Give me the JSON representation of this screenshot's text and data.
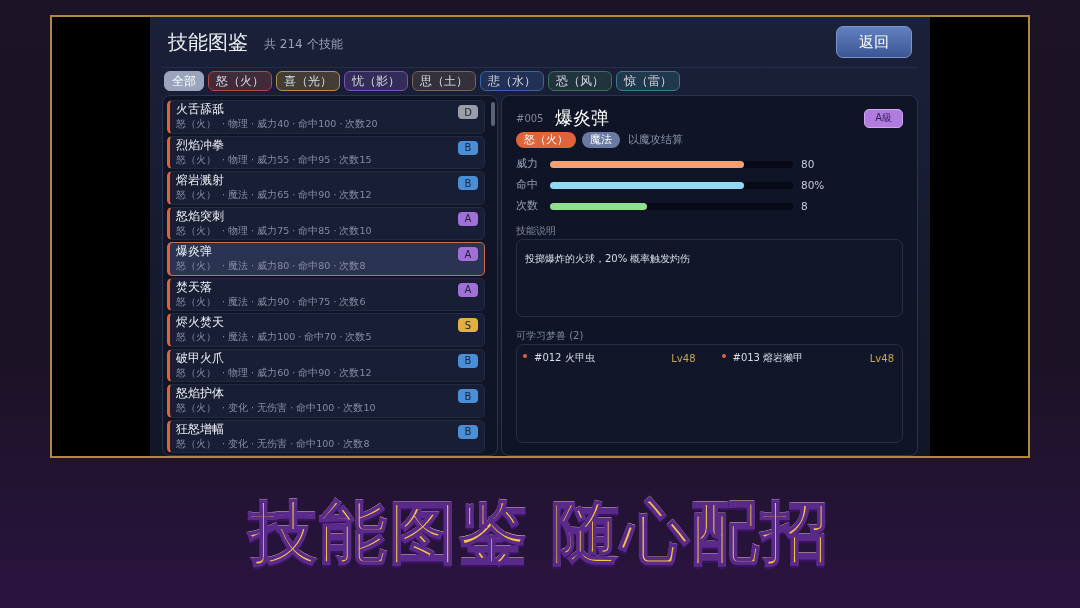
{
  "header": {
    "title": "技能图鉴",
    "count": "共 214 个技能",
    "back_button": "返回"
  },
  "tabs": [
    {
      "label": "全部",
      "selected": true,
      "color": "#9aa4bc"
    },
    {
      "label": "怒（火）",
      "selected": false,
      "color": "#b04a42"
    },
    {
      "label": "喜（光）",
      "selected": false,
      "color": "#b8923a"
    },
    {
      "label": "忧（影）",
      "selected": false,
      "color": "#7a52b8"
    },
    {
      "label": "思（土）",
      "selected": false,
      "color": "#806250"
    },
    {
      "label": "悲（水）",
      "selected": false,
      "color": "#3a62a8"
    },
    {
      "label": "恐（风）",
      "selected": false,
      "color": "#3a7258"
    },
    {
      "label": "惊（雷）",
      "selected": false,
      "color": "#3a7c8c"
    }
  ],
  "skills": [
    {
      "name": "火舌舔舐",
      "meta": "怒（火）  · 物理 · 威力40 · 命中100 · 次数20",
      "grade": "D",
      "color": "#9a9ea8",
      "selected": false
    },
    {
      "name": "烈焰冲拳",
      "meta": "怒（火）  · 物理 · 威力55 · 命中95 · 次数15",
      "grade": "B",
      "color": "#4a8ed6",
      "selected": false
    },
    {
      "name": "熔岩溅射",
      "meta": "怒（火）  · 魔法 · 威力65 · 命中90 · 次数12",
      "grade": "B",
      "color": "#4a8ed6",
      "selected": false
    },
    {
      "name": "怒焰突刺",
      "meta": "怒（火）  · 物理 · 威力75 · 命中85 · 次数10",
      "grade": "A",
      "color": "#a070d8",
      "selected": false
    },
    {
      "name": "爆炎弹",
      "meta": "怒（火）  · 魔法 · 威力80 · 命中80 · 次数8",
      "grade": "A",
      "color": "#a070d8",
      "selected": true
    },
    {
      "name": "焚天落",
      "meta": "怒（火）  · 魔法 · 威力90 · 命中75 · 次数6",
      "grade": "A",
      "color": "#a070d8",
      "selected": false
    },
    {
      "name": "烬火焚天",
      "meta": "怒（火）  · 魔法 · 威力100 · 命中70 · 次数5",
      "grade": "S",
      "color": "#e0b040",
      "selected": false
    },
    {
      "name": "破甲火爪",
      "meta": "怒（火）  · 物理 · 威力60 · 命中90 · 次数12",
      "grade": "B",
      "color": "#4a8ed6",
      "selected": false
    },
    {
      "name": "怒焰护体",
      "meta": "怒（火）  · 变化 · 无伤害 · 命中100 · 次数10",
      "grade": "B",
      "color": "#4a8ed6",
      "selected": false
    },
    {
      "name": "狂怒增幅",
      "meta": "怒（火）  · 变化 · 无伤害 · 命中100 · 次数8",
      "grade": "B",
      "color": "#4a8ed6",
      "selected": false
    }
  ],
  "detail": {
    "number": "#005",
    "name": "爆炎弹",
    "grade": "A級",
    "tags": [
      {
        "label": "怒（火）",
        "color": "#e0643a"
      },
      {
        "label": "魔法",
        "color": "#6a7aa0"
      }
    ],
    "note": "以魔攻结算",
    "stats": [
      {
        "label": "威力",
        "level": 0.8,
        "value": "80",
        "color": "#f4a070"
      },
      {
        "label": "命中",
        "level": 0.8,
        "value": "80%",
        "color": "#90d8f4"
      },
      {
        "label": "次数",
        "level": 0.4,
        "value": "8",
        "color": "#90e090"
      }
    ],
    "description_label": "技能说明",
    "description": "投掷爆炸的火球，20% 概率触发灼伤",
    "learners_label": "可学习梦兽 (2)",
    "learners": [
      {
        "name": "#012 火甲虫",
        "level": "Lv48",
        "color": "#e0643a"
      },
      {
        "name": "#013 熔岩獭甲",
        "level": "Lv48",
        "color": "#e0643a"
      }
    ]
  },
  "banner": [
    "技能图鉴",
    "随心配招"
  ]
}
